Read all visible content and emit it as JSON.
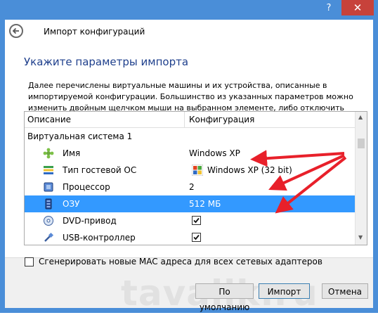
{
  "titlebar": {
    "help": "?",
    "close": "✕"
  },
  "header": {
    "title": "Импорт конфигураций"
  },
  "content": {
    "subtitle": "Укажите параметры импорта",
    "description": "Далее перечислены виртуальные машины и их устройства, описанные в импортируемой конфигурации. Большинство из указанных параметров можно изменить двойным щелчком мыши на выбранном элементе, либо отключить используя соответствующие галочки."
  },
  "tree": {
    "col_description": "Описание",
    "col_configuration": "Конфигурация",
    "system": "Виртуальная система 1",
    "rows": [
      {
        "label": "Имя",
        "value": "Windows XP",
        "icon": "name-icon"
      },
      {
        "label": "Тип гостевой ОС",
        "value": "Windows XP (32 bit)",
        "icon": "os-type-icon"
      },
      {
        "label": "Процессор",
        "value": "2",
        "icon": "cpu-icon"
      },
      {
        "label": "ОЗУ",
        "value": "512 МБ",
        "icon": "ram-icon"
      },
      {
        "label": "DVD-привод",
        "value": "",
        "icon": "dvd-icon",
        "checked": true
      },
      {
        "label": "USB-контроллер",
        "value": "",
        "icon": "usb-icon",
        "checked": true
      }
    ]
  },
  "mac": {
    "label": "Сгенерировать новые MAC адреса для всех сетевых адаптеров",
    "checked": false
  },
  "buttons": {
    "defaults": "По умолчанию",
    "import": "Импорт",
    "cancel": "Отмена"
  },
  "watermark": "tavalik.ru",
  "colors": {
    "titlebar": "#4a8ed8",
    "close": "#c7423b",
    "selection": "#3399ff",
    "subtitle": "#1e3f8c",
    "arrow": "#e8202a"
  }
}
